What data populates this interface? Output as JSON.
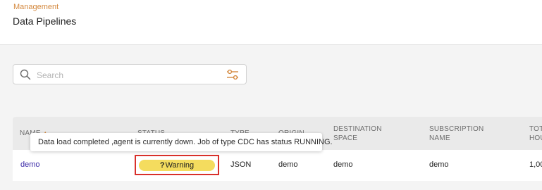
{
  "header": {
    "breadcrumb": "Management",
    "title": "Data Pipelines"
  },
  "search": {
    "placeholder": "Search",
    "value": ""
  },
  "icons": {
    "search": "search-icon",
    "filter": "filter-sliders-icon",
    "status_glyph": "question-icon"
  },
  "table": {
    "columns": {
      "name": "NAME",
      "status": "STATUS",
      "type": "TYPE",
      "origin": "ORIGIN",
      "destination_line1": "DESTINATION",
      "destination_line2": "SPACE",
      "subscription_line1": "SUBSCRIPTION",
      "subscription_line2": "NAME",
      "total_line1": "TOT",
      "total_line2": "HOU"
    },
    "sort_indicator": "▲",
    "rows": [
      {
        "name": "demo",
        "status_glyph": "?",
        "status": "Warning",
        "type": "JSON",
        "origin": "demo",
        "destination": "demo",
        "subscription": "demo",
        "total": "1,00"
      }
    ]
  },
  "tooltip": {
    "text": "Data load completed ,agent is currently down. Job of type CDC has status RUNNING."
  },
  "colors": {
    "accent": "#d4893f",
    "link": "#3b2aa8",
    "warning_badge": "#f4dc5e",
    "highlight_box": "#d9302b"
  }
}
